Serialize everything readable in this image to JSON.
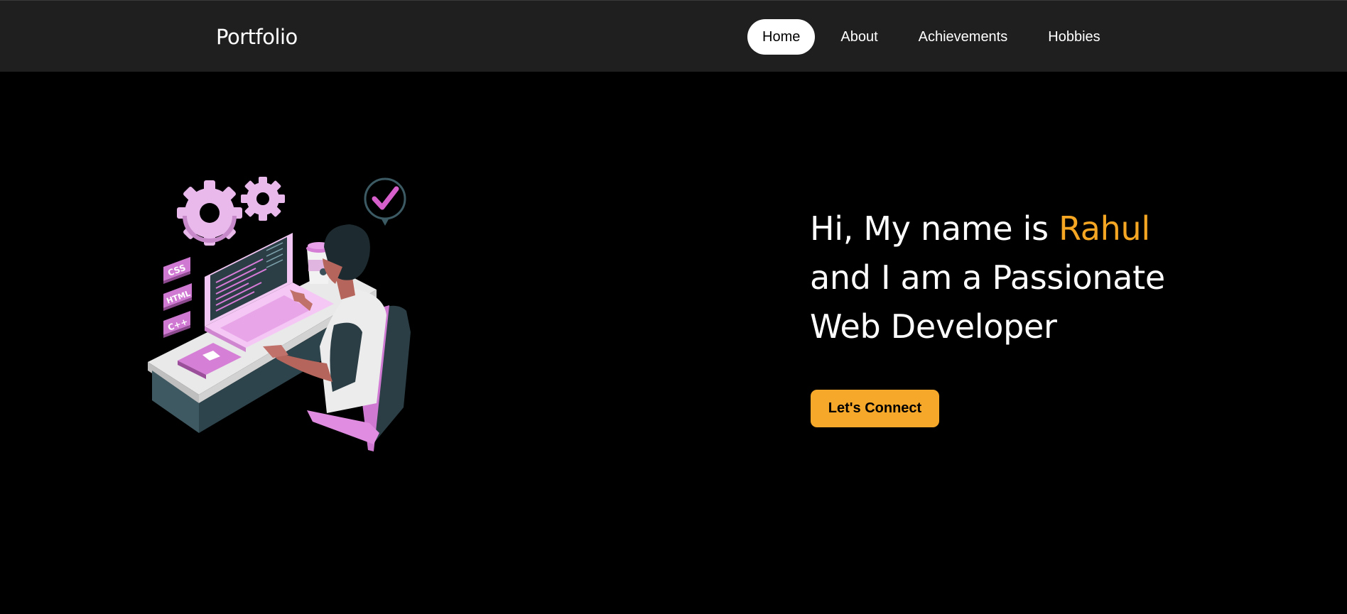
{
  "navbar": {
    "brand": "Portfolio",
    "items": [
      {
        "label": "Home",
        "active": true
      },
      {
        "label": "About",
        "active": false
      },
      {
        "label": "Achievements",
        "active": false
      },
      {
        "label": "Hobbies",
        "active": false
      }
    ]
  },
  "hero": {
    "greeting_prefix": "Hi, My name is ",
    "name": "Rahul",
    "line2": "and I am a Passionate",
    "line3": "Web Developer",
    "cta_label": "Let's Connect",
    "illustration": {
      "tags": [
        "CSS",
        "HTML",
        "C++"
      ]
    }
  },
  "colors": {
    "accent": "#f6a82a",
    "navbar_bg": "#1f1f1f",
    "page_bg": "#000000",
    "illustration_pink": "#e493e0"
  }
}
